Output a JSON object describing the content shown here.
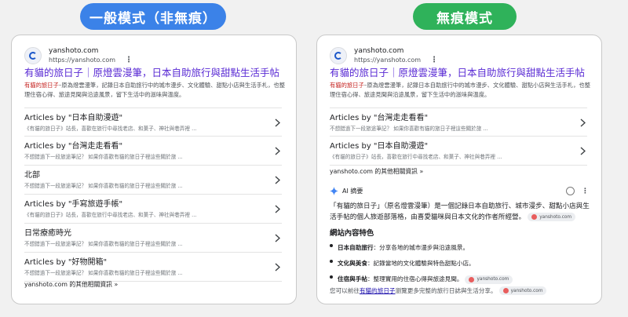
{
  "labels": {
    "left": "一般模式（非無痕）",
    "right": "無痕模式"
  },
  "result": {
    "site_name": "yanshoto.com",
    "site_url": "https://yanshoto.com",
    "more_icon": "⋮",
    "title": "有貓的旅日子｜原燈雲漫筆，日本自助旅行與甜點生活手帖",
    "snippet_highlight": "有貓的旅日子",
    "snippet_rest": "–原為燈雲漫筆，記錄日本自助旅行中的城市漫步、文化體驗、甜點小店與生活手札，也整理住宿心得、旅途見聞與沿途風景，留下生活中的滋味與溫度。"
  },
  "left_rows": [
    {
      "title": "Articles by \"日本自助漫遊\"",
      "desc": "《有貓的旅日子》站長，喜歡在旅行中尋找老店、和菓子、神社與巷弄裡 ..."
    },
    {
      "title": "Articles by \"台灣走走看看\"",
      "desc": "不想錯過下一段旅途筆記？ 如果你喜歡有貓的旅日子裡這些關於旅 ..."
    },
    {
      "title": "北部",
      "desc": "不想錯過下一段旅途筆記？ 如果你喜歡有貓的旅日子裡這些關於旅 ..."
    },
    {
      "title": "Articles by \"手寫旅遊手帳\"",
      "desc": "《有貓的旅日子》站長，喜歡在旅行中尋找老店、和菓子、神社與巷弄裡 ..."
    },
    {
      "title": "日常療癒時光",
      "desc": "不想錯過下一段旅途筆記？ 如果你喜歡有貓的旅日子裡這些關於旅 ..."
    },
    {
      "title": "Articles by \"好物開箱\"",
      "desc": "不想錯過下一段旅途筆記？ 如果你喜歡有貓的旅日子裡這些關於旅 ..."
    }
  ],
  "right_rows": [
    {
      "title": "Articles by \"台灣走走看看\"",
      "desc": "不想錯過下一段旅途筆記？ 如果你喜歡有貓的旅日子裡這些關於旅 ..."
    },
    {
      "title": "Articles by \"日本自助漫遊\"",
      "desc": "《有貓的旅日子》站長，喜歡在旅行中尋找老店、和菓子、神社與巷弄裡 ..."
    }
  ],
  "more_results": "yanshoto.com 的其他相關資訊 »",
  "ai": {
    "label": "AI 摘要",
    "body": "「有貓的旅日子」（原名燈雲漫筆）是一個記錄日本自助旅行、城市漫步、甜點小店與生活手帖的個人旅遊部落格，由喜愛貓咪與日本文化的作者所經營。",
    "chip": "yanshoto.com",
    "section_title": "網站內容特色",
    "bullets": [
      {
        "bold": "日本自助旅行",
        "text": "：分享各地的城市漫步與沿途風景。",
        "chip": ""
      },
      {
        "bold": "文化與美食",
        "text": "：記錄當地的文化體驗與特色甜點小店。",
        "chip": ""
      },
      {
        "bold": "住宿與手帖",
        "text": "：整理實用的住宿心得與旅途見聞。",
        "chip": "yanshoto.com"
      }
    ],
    "footer_pre": "您可以前往",
    "footer_link": "有貓的旅日子",
    "footer_post": "瀏覽更多完整的旅行日誌與生活分享。",
    "footer_chip": "yanshoto.com"
  },
  "colors": {
    "left_pill": "#3b82e8",
    "right_pill": "#2fb25a",
    "title_link": "#5a2bd4",
    "highlight": "#c5221f"
  }
}
